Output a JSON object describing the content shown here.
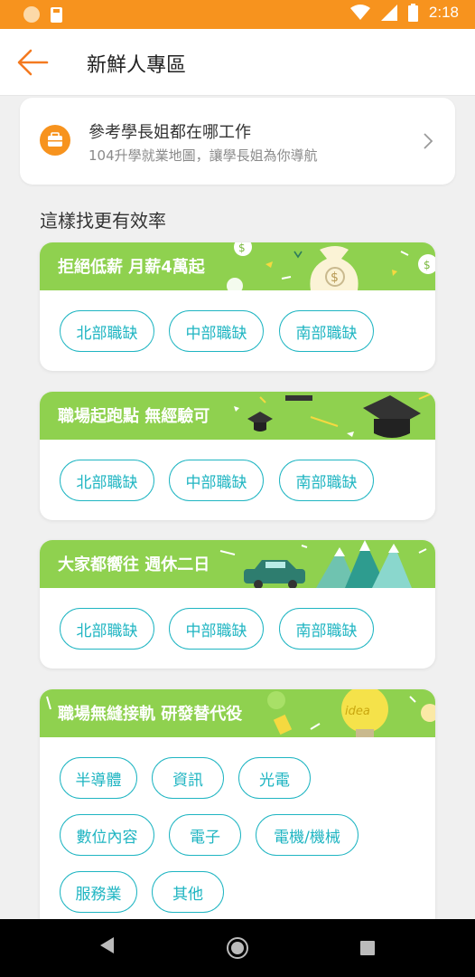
{
  "status_bar": {
    "time": "2:18"
  },
  "header": {
    "title": "新鮮人專區"
  },
  "alumni_card": {
    "title": "參考學長姐都在哪工作",
    "subtitle": "104升學就業地圖，讓學長姐為你導航"
  },
  "section": {
    "title": "這樣找更有效率"
  },
  "cards": [
    {
      "banner": "拒絕低薪 月薪4萬起",
      "chips": [
        "北部職缺",
        "中部職缺",
        "南部職缺"
      ]
    },
    {
      "banner": "職場起跑點 無經驗可",
      "chips": [
        "北部職缺",
        "中部職缺",
        "南部職缺"
      ]
    },
    {
      "banner": "大家都嚮往 週休二日",
      "chips": [
        "北部職缺",
        "中部職缺",
        "南部職缺"
      ]
    },
    {
      "banner": "職場無縫接軌 研發替代役",
      "chips": [
        "半導體",
        "資訊",
        "光電",
        "數位內容",
        "電子",
        "電機/機械",
        "服務業",
        "其他"
      ]
    }
  ],
  "colors": {
    "status_bar": "#f7931e",
    "accent": "#f47a20",
    "banner_green": "#8fd14f",
    "chip_teal": "#1fb5c2"
  }
}
